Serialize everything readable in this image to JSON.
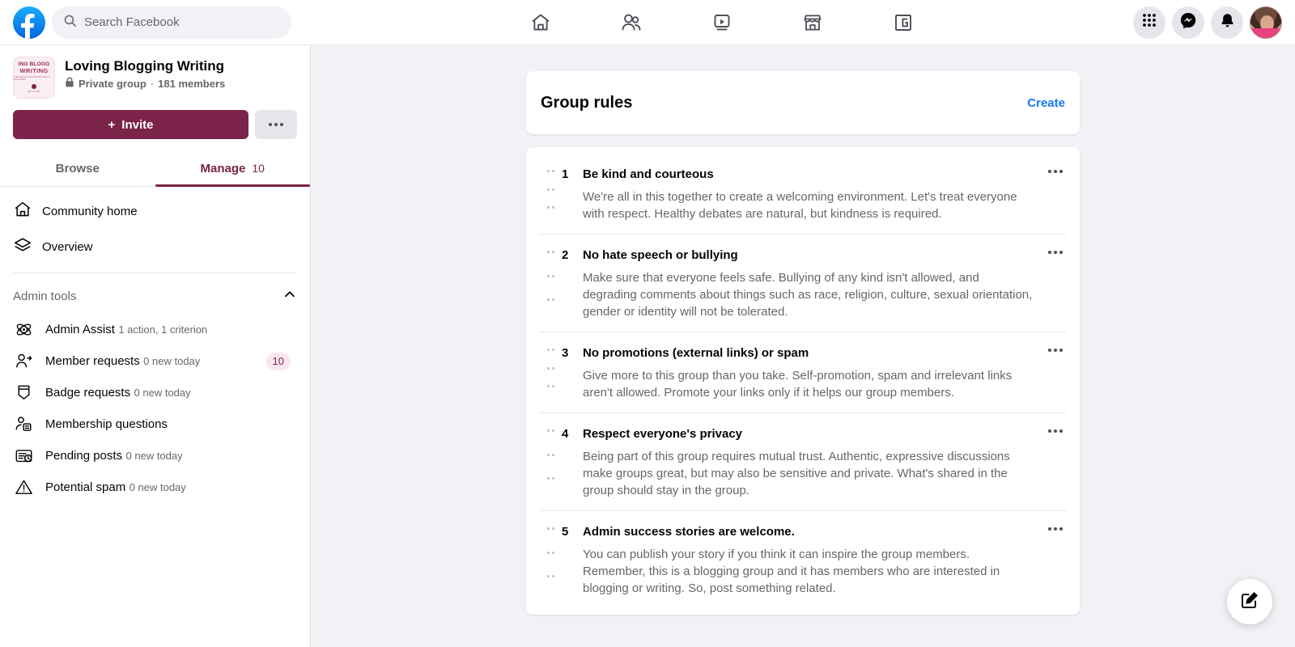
{
  "topbar": {
    "logo": "facebook-logo",
    "search": {
      "placeholder": "Search Facebook",
      "value": ""
    },
    "nav": [
      {
        "name": "home",
        "icon": "home-icon"
      },
      {
        "name": "friends",
        "icon": "friends-icon"
      },
      {
        "name": "watch",
        "icon": "video-play-icon"
      },
      {
        "name": "marketplace",
        "icon": "storefront-icon"
      },
      {
        "name": "gaming",
        "icon": "gaming-icon"
      }
    ],
    "right": [
      {
        "name": "menu",
        "icon": "grid-menu-icon"
      },
      {
        "name": "messenger",
        "icon": "messenger-icon"
      },
      {
        "name": "notifications",
        "icon": "bell-icon"
      },
      {
        "name": "account",
        "icon": "avatar"
      }
    ]
  },
  "sidebar": {
    "group": {
      "name": "Loving Blogging Writing",
      "privacy": "Private group",
      "separator": "·",
      "members": "181 members",
      "thumb_line1": "ING BLOGG",
      "thumb_line2": "WRITING",
      "thumb_line3": "THE TRICKS TO PROMOTE THE ALL BLOGGERS"
    },
    "invite_label": "Invite",
    "invite_plus": "+",
    "more_label": "More options",
    "tabs": [
      {
        "label": "Browse",
        "count": "",
        "active": false
      },
      {
        "label": "Manage",
        "count": "10",
        "active": true
      }
    ],
    "nav_items": [
      {
        "label": "Community home",
        "icon": "home-icon"
      },
      {
        "label": "Overview",
        "icon": "layers-icon"
      }
    ],
    "section": {
      "title": "Admin tools",
      "collapse_icon": "chevron-up-icon"
    },
    "tools": [
      {
        "label": "Admin Assist",
        "sub": "1 action, 1 criterion",
        "badge": "",
        "icon": "admin-assist-icon"
      },
      {
        "label": "Member requests",
        "sub": "0 new today",
        "badge": "10",
        "icon": "member-request-icon"
      },
      {
        "label": "Badge requests",
        "sub": "0 new today",
        "badge": "",
        "icon": "badge-icon"
      },
      {
        "label": "Membership questions",
        "sub": "",
        "badge": "",
        "icon": "membership-questions-icon"
      },
      {
        "label": "Pending posts",
        "sub": "0 new today",
        "badge": "",
        "icon": "pending-posts-icon"
      },
      {
        "label": "Potential spam",
        "sub": "0 new today",
        "badge": "",
        "icon": "warning-icon"
      }
    ]
  },
  "main": {
    "header": {
      "title": "Group rules",
      "create_label": "Create"
    },
    "rules": [
      {
        "number": "1",
        "title": "Be kind and courteous",
        "description": "We're all in this together to create a welcoming environment. Let's treat everyone with respect. Healthy debates are natural, but kindness is required."
      },
      {
        "number": "2",
        "title": "No hate speech or bullying",
        "description": "Make sure that everyone feels safe. Bullying of any kind isn't allowed, and degrading comments about things such as race, religion, culture, sexual orientation, gender or identity will not be tolerated."
      },
      {
        "number": "3",
        "title": "No promotions (external links) or spam",
        "description": "Give more to this group than you take. Self-promotion, spam and irrelevant links aren't allowed. Promote your links only if it helps our group members."
      },
      {
        "number": "4",
        "title": "Respect everyone's privacy",
        "description": "Being part of this group requires mutual trust. Authentic, expressive discussions make groups great, but may also be sensitive and private. What's shared in the group should stay in the group."
      },
      {
        "number": "5",
        "title": "Admin success stories are welcome.",
        "description": "You can publish your story if you think it can inspire the group members. Remember, this is a blogging group and it has members who are interested in blogging or writing. So, post something related."
      }
    ]
  },
  "fab": {
    "icon": "compose-icon"
  },
  "colors": {
    "brand_blue": "#1877f2",
    "group_maroon": "#7b2348",
    "badge_bg": "#fae6ef",
    "page_bg": "#f0f2f5",
    "text_primary": "#050505",
    "text_secondary": "#65676b"
  }
}
